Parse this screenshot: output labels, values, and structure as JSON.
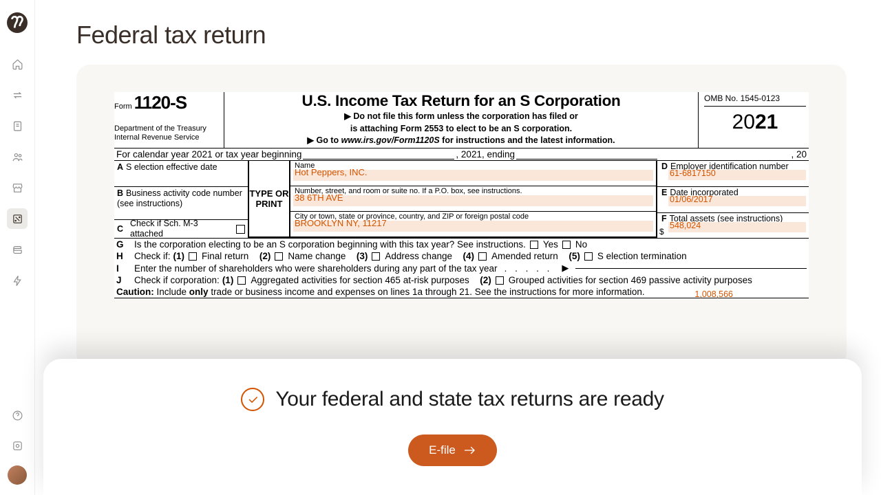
{
  "page": {
    "title": "Federal tax return"
  },
  "form": {
    "form_label": "Form",
    "form_number": "1120-S",
    "dept": "Department of the Treasury\nInternal Revenue Service",
    "title": "U.S. Income Tax Return for an S Corporation",
    "note_line1": "▶ Do not file this form unless the corporation has filed or",
    "note_line2": "is attaching Form 2553 to elect to be an S corporation.",
    "note_line3_pre": "▶ Go to ",
    "note_line3_em": "www.irs.gov/Form1120S",
    "note_line3_post": " for instructions and the latest information.",
    "omb": "OMB No. 1545-0123",
    "year_thin": "20",
    "year_bold": "21",
    "cal_pre": "For calendar year 2021 or tax year beginning",
    "cal_mid": ", 2021, ending",
    "cal_end": ", 20",
    "A_label": "S election effective date",
    "B_label": "Business activity code number (see instructions)",
    "C_label": "Check if Sch. M-3 attached",
    "type_or_print": "TYPE OR PRINT",
    "name_label": "Name",
    "name_value": "Hot Peppers, INC.",
    "street_label": "Number, street, and room or suite no. If a P.O. box, see instructions.",
    "street_value": "38 6TH AVE",
    "city_label": "City or town, state or province, country, and ZIP or foreign postal code",
    "city_value": "BROOKLYN NY, 11217",
    "D_label": "Employer identification number",
    "D_value": "61-6817150",
    "E_label": "Date incorporated",
    "E_value": "01/06/2017",
    "F_label": "Total assets (see instructions)",
    "F_value": "548,024",
    "G_text": "Is the corporation electing to be an S corporation beginning with this tax year? See instructions.",
    "G_yes": "Yes",
    "G_no": "No",
    "H_pre": "Check if:",
    "H1": "Final return",
    "H2": "Name change",
    "H3": "Address change",
    "H4": "Amended return",
    "H5": "S election termination",
    "I_text": "Enter the number of shareholders who were shareholders during any part of the tax year",
    "J_pre": "Check if corporation:",
    "J1": "Aggregated activities for section 465 at-risk purposes",
    "J2": "Grouped activities for section 469 passive activity purposes",
    "caution_label": "Caution:",
    "caution_text_pre": " Include ",
    "caution_only": "only",
    "caution_text_post": " trade or business income and expenses on lines 1a through 21. See the instructions for more information.",
    "overflow_value": "1,008,566"
  },
  "bottom": {
    "ready": "Your federal and state tax returns are ready",
    "efile": "E-file"
  },
  "letters": {
    "A": "A",
    "B": "B",
    "C": "C",
    "D": "D",
    "E": "E",
    "F": "F",
    "G": "G",
    "H": "H",
    "I": "I",
    "J": "J"
  },
  "nums": {
    "n1": "(1)",
    "n2": "(2)",
    "n3": "(3)",
    "n4": "(4)",
    "n5": "(5)"
  }
}
